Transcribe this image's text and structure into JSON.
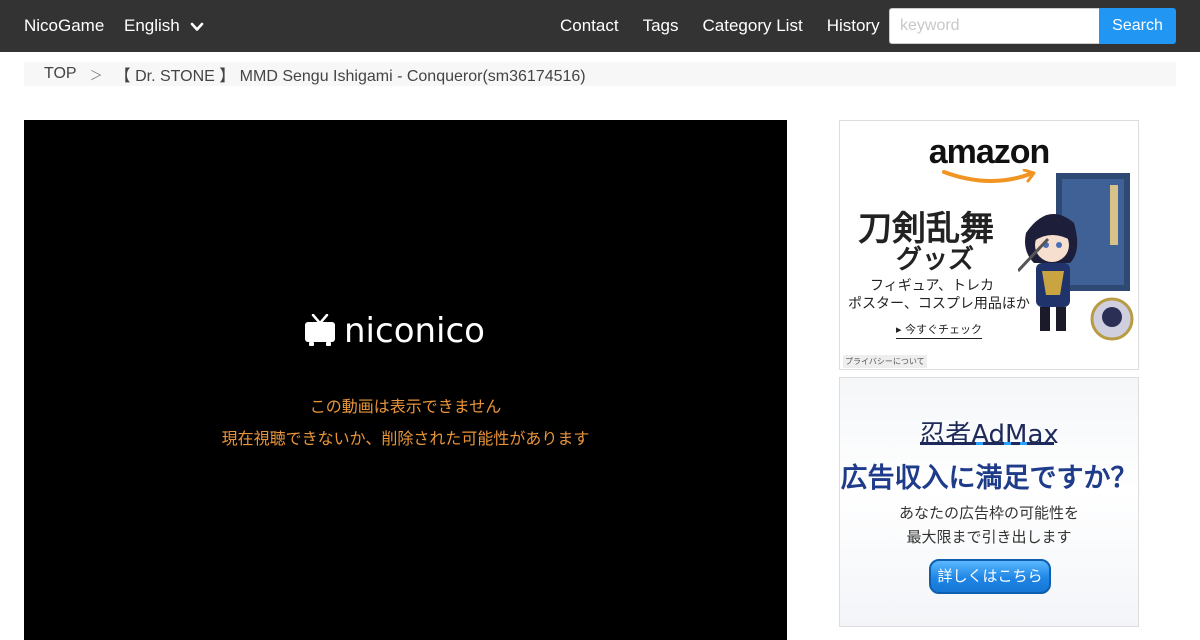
{
  "nav": {
    "brand": "NicoGame",
    "language": "English",
    "links": [
      "Contact",
      "Tags",
      "Category List",
      "History"
    ],
    "search": {
      "placeholder": "keyword",
      "button_label": "Search"
    },
    "colors": {
      "bar": "#333333",
      "search_button": "#2196f3"
    }
  },
  "breadcrumb": {
    "home": "TOP",
    "separator": "＞",
    "current": "【 Dr. STONE 】 MMD Sengu Ishigami - Conqueror(sm36174516)"
  },
  "player": {
    "logo_text": "niconico",
    "error_line1": "この動画は表示できません",
    "error_line2": "現在視聴できないか、削除された可能性があります",
    "error_color": "#e8953a"
  },
  "ads": {
    "amazon": {
      "logo": "amazon",
      "headline1": "刀剣乱舞",
      "headline2": "グッズ",
      "sub1": "フィギュア、トレカ",
      "sub2": "ポスター、コスプレ用品ほか",
      "cta": "▸ 今すぐチェック",
      "privacy": "プライバシーについて"
    },
    "ninja": {
      "logo": "忍者AdMax",
      "headline": "広告収入に満足ですか？",
      "sub1": "あなたの広告枠の可能性を",
      "sub2": "最大限まで引き出します",
      "button": "詳しくはこちら"
    }
  }
}
